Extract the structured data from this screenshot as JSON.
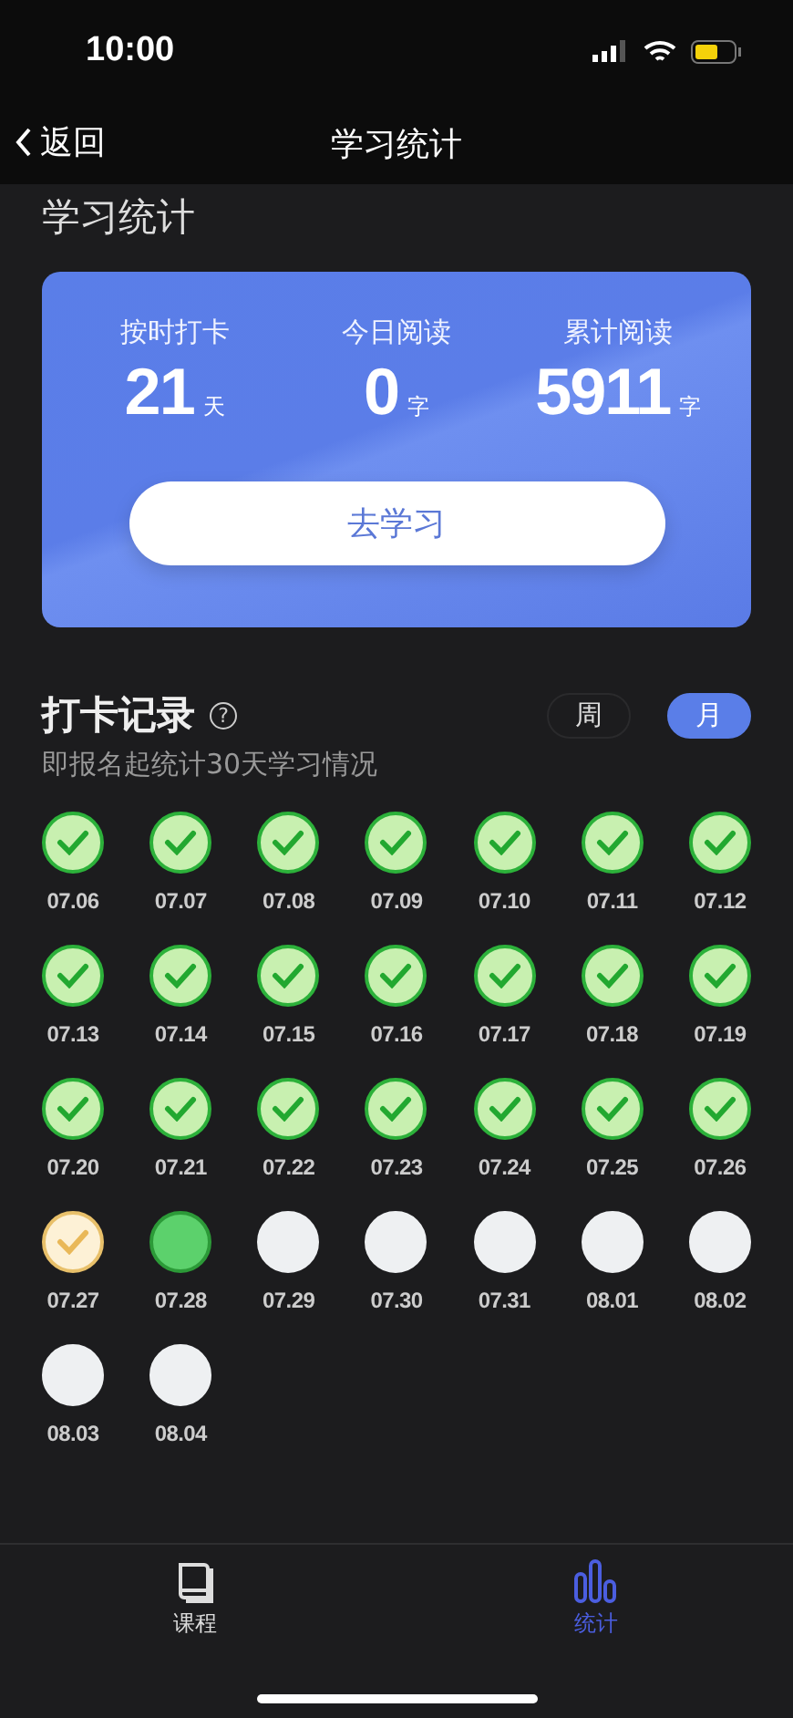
{
  "status_bar": {
    "time": "10:00"
  },
  "nav_bar": {
    "back": "返回",
    "title": "学习统计"
  },
  "section_title": "学习统计",
  "stats_card": {
    "stats": [
      {
        "label": "按时打卡",
        "value": "21",
        "unit": "天"
      },
      {
        "label": "今日阅读",
        "value": "0",
        "unit": "字"
      },
      {
        "label": "累计阅读",
        "value": "5911",
        "unit": "字"
      }
    ],
    "button": "去学习"
  },
  "record": {
    "title": "打卡记录",
    "help": "?",
    "subtitle": "即报名起统计30天学习情况",
    "periods": [
      {
        "label": "周",
        "selected": false
      },
      {
        "label": "月",
        "selected": true
      }
    ],
    "days": [
      {
        "date": "07.06",
        "kind": "done"
      },
      {
        "date": "07.07",
        "kind": "done"
      },
      {
        "date": "07.08",
        "kind": "done"
      },
      {
        "date": "07.09",
        "kind": "done"
      },
      {
        "date": "07.10",
        "kind": "done"
      },
      {
        "date": "07.11",
        "kind": "done"
      },
      {
        "date": "07.12",
        "kind": "done"
      },
      {
        "date": "07.13",
        "kind": "done"
      },
      {
        "date": "07.14",
        "kind": "done"
      },
      {
        "date": "07.15",
        "kind": "done"
      },
      {
        "date": "07.16",
        "kind": "done"
      },
      {
        "date": "07.17",
        "kind": "done"
      },
      {
        "date": "07.18",
        "kind": "done"
      },
      {
        "date": "07.19",
        "kind": "done"
      },
      {
        "date": "07.20",
        "kind": "done"
      },
      {
        "date": "07.21",
        "kind": "done"
      },
      {
        "date": "07.22",
        "kind": "done"
      },
      {
        "date": "07.23",
        "kind": "done"
      },
      {
        "date": "07.24",
        "kind": "done"
      },
      {
        "date": "07.25",
        "kind": "done"
      },
      {
        "date": "07.26",
        "kind": "done"
      },
      {
        "date": "07.27",
        "kind": "late"
      },
      {
        "date": "07.28",
        "kind": "today"
      },
      {
        "date": "07.29",
        "kind": "pending"
      },
      {
        "date": "07.30",
        "kind": "pending"
      },
      {
        "date": "07.31",
        "kind": "pending"
      },
      {
        "date": "08.01",
        "kind": "pending"
      },
      {
        "date": "08.02",
        "kind": "pending"
      },
      {
        "date": "08.03",
        "kind": "pending"
      },
      {
        "date": "08.04",
        "kind": "pending"
      }
    ]
  },
  "tab_bar": [
    {
      "label": "课程",
      "kind": "book",
      "selected": false
    },
    {
      "label": "统计",
      "kind": "chart",
      "selected": true
    }
  ]
}
